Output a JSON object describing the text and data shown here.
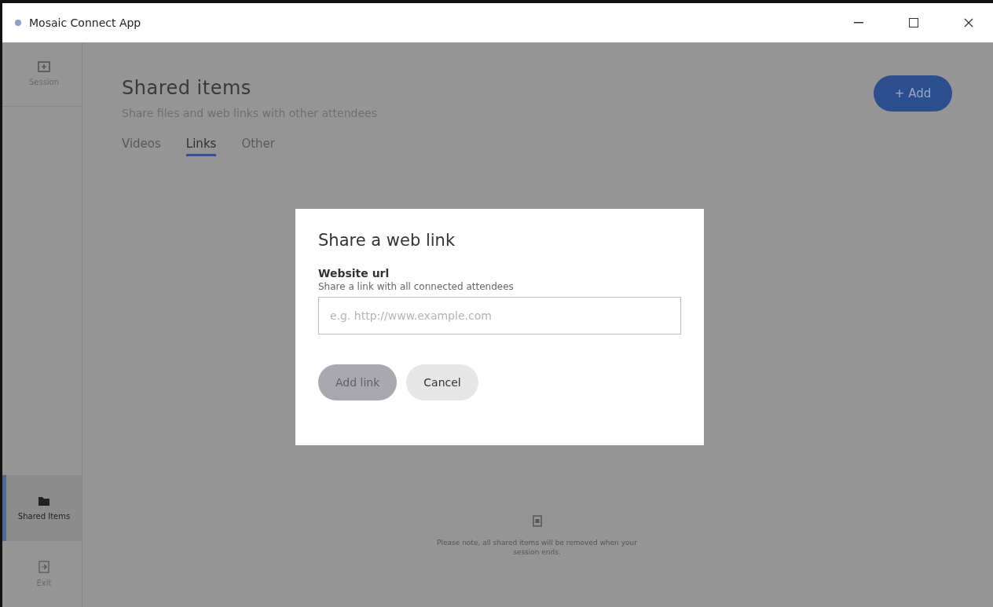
{
  "window": {
    "title": "Mosaic Connect App"
  },
  "sidebar": {
    "items": [
      {
        "label": "Session",
        "selected": false
      },
      {
        "label": "Shared Items",
        "selected": true
      },
      {
        "label": "Exit",
        "selected": false
      }
    ]
  },
  "page": {
    "title": "Shared items",
    "subtitle": "Share files and web links with other attendees",
    "add_button": "+ Add",
    "tabs": [
      {
        "label": "Videos",
        "selected": false
      },
      {
        "label": "Links",
        "selected": true
      },
      {
        "label": "Other",
        "selected": false
      }
    ],
    "note": "Please note, all shared items will be removed when your session ends."
  },
  "dialog": {
    "title": "Share a web link",
    "field_label": "Website url",
    "field_help": "Share a link with all connected attendees",
    "placeholder": "e.g. http://www.example.com",
    "buttons": [
      {
        "label": "Add link",
        "kind": "primary",
        "disabled": true
      },
      {
        "label": "Cancel",
        "kind": "secondary",
        "disabled": false
      }
    ]
  }
}
